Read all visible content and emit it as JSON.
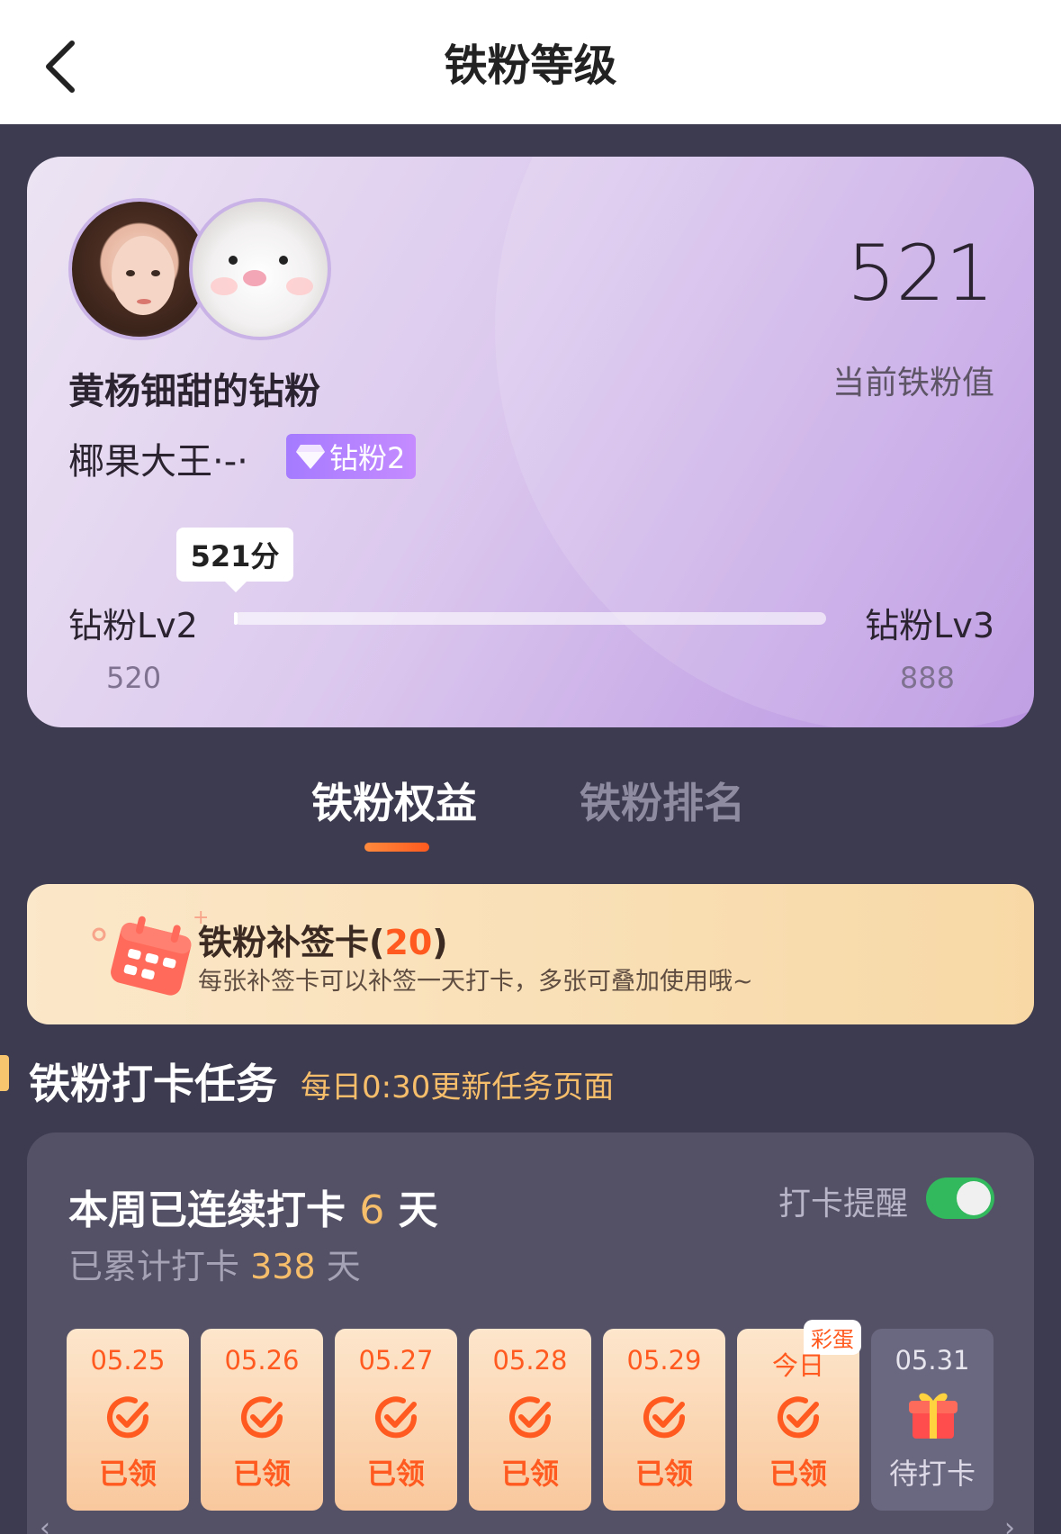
{
  "header": {
    "title": "铁粉等级",
    "back_icon": "chevron-left-icon"
  },
  "profile": {
    "fan_title": "黄杨钿甜的钻粉",
    "user_name": "椰果大王·-·",
    "badge_label": "钻粉2",
    "badge_icon": "diamond-icon",
    "fan_value": "521",
    "fan_value_label": "当前铁粉值",
    "score_bubble": "521分",
    "level_current": "钻粉Lv2",
    "level_next": "钻粉Lv3",
    "level_min": "520",
    "level_max": "888",
    "progress_fraction": 0.003
  },
  "tabs": [
    {
      "label": "铁粉权益",
      "active": true
    },
    {
      "label": "铁粉排名",
      "active": false
    }
  ],
  "banner": {
    "title": "铁粉补签卡",
    "count": "20",
    "description": "每张补签卡可以补签一天打卡，多张可叠加使用哦~"
  },
  "section": {
    "title": "铁粉打卡任务",
    "subtitle": "每日0:30更新任务页面"
  },
  "checkin": {
    "streak_prefix": "本周已连续打卡",
    "streak_days": "6",
    "streak_suffix": "天",
    "total_prefix": "已累计打卡",
    "total_days": "338",
    "total_suffix": "天",
    "remind_label": "打卡提醒",
    "remind_on": true,
    "days": [
      {
        "date": "05.25",
        "status": "已领"
      },
      {
        "date": "05.26",
        "status": "已领"
      },
      {
        "date": "05.27",
        "status": "已领"
      },
      {
        "date": "05.28",
        "status": "已领"
      },
      {
        "date": "05.29",
        "status": "已领"
      },
      {
        "date": "今日",
        "status": "已领",
        "tag": "彩蛋"
      },
      {
        "date": "05.31",
        "status": "待打卡"
      }
    ]
  },
  "colors": {
    "accent_orange": "#ff5a1f",
    "gold": "#f6bd6a",
    "toggle_green": "#32b85d",
    "badge_purple": "#a57bff"
  }
}
